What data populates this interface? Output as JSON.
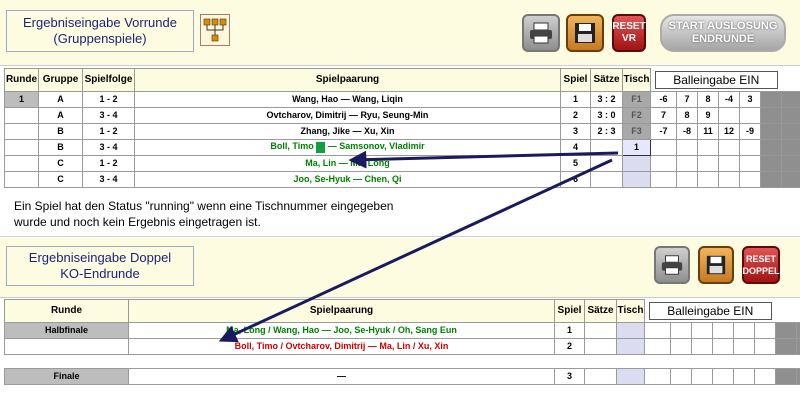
{
  "vr": {
    "title_line1": "Ergebniseingabe Vorrunde",
    "title_line2": "(Gruppenspiele)",
    "icons": {
      "tree": "bracket-tree-icon",
      "print": "printer-icon",
      "save": "floppy-disk-icon"
    },
    "reset_label": "RESET VR",
    "start_label": "START AUSLOSUNG ENDRUNDE",
    "ball_label": "Balleingabe EIN",
    "headers": {
      "runde": "Runde",
      "gruppe": "Gruppe",
      "spielfolge": "Spielfolge",
      "spielpaarung": "Spielpaarung",
      "spiel": "Spiel",
      "saetze": "Sätze",
      "tisch": "Tisch"
    },
    "rows": [
      {
        "runde": "1",
        "gruppe": "A",
        "folge": "1 - 2",
        "p1": "Wang, Hao",
        "sep": "—",
        "p2": "Wang, Liqin",
        "spiel": "1",
        "saetze": "3 : 2",
        "tisch": "F1",
        "sets": [
          "-6",
          "7",
          "8",
          "-4",
          "3"
        ],
        "color": "black"
      },
      {
        "runde": "",
        "gruppe": "A",
        "folge": "3 - 4",
        "p1": "Ovtcharov, Dimitrij",
        "sep": "—",
        "p2": "Ryu, Seung-Min",
        "spiel": "2",
        "saetze": "3 : 0",
        "tisch": "F2",
        "sets": [
          "7",
          "8",
          "9",
          "",
          ""
        ],
        "color": "black"
      },
      {
        "runde": "",
        "gruppe": "B",
        "folge": "1 - 2",
        "p1": "Zhang, Jike",
        "sep": "—",
        "p2": "Xu, Xin",
        "spiel": "3",
        "saetze": "2 : 3",
        "tisch": "F3",
        "sets": [
          "-7",
          "-8",
          "11",
          "12",
          "-9"
        ],
        "color": "black"
      },
      {
        "runde": "",
        "gruppe": "B",
        "folge": "3 - 4",
        "p1": "Boll, Timo",
        "sep": "—",
        "p2": "Samsonov, Vladimir",
        "spiel": "4",
        "saetze": "",
        "tisch": "1",
        "sets": [
          "",
          "",
          "",
          "",
          ""
        ],
        "color": "green"
      },
      {
        "runde": "",
        "gruppe": "C",
        "folge": "1 - 2",
        "p1": "Ma, Lin",
        "sep": "—",
        "p2": "Ma, Long",
        "spiel": "5",
        "saetze": "",
        "tisch": "",
        "sets": [
          "",
          "",
          "",
          "",
          ""
        ],
        "color": "green"
      },
      {
        "runde": "",
        "gruppe": "C",
        "folge": "3 - 4",
        "p1": "Joo, Se-Hyuk",
        "sep": "—",
        "p2": "Chen, Qi",
        "spiel": "6",
        "saetze": "",
        "tisch": "",
        "sets": [
          "",
          "",
          "",
          "",
          ""
        ],
        "color": "green"
      }
    ]
  },
  "note": {
    "line1": "Ein Spiel hat den Status \"running\" wenn eine Tischnummer eingegeben",
    "line2": "wurde und noch kein Ergebnis eingetragen ist."
  },
  "ko": {
    "title_line1": "Ergebniseingabe Doppel",
    "title_line2": "KO-Endrunde",
    "reset_label": "RESET DOPPEL",
    "ball_label": "Balleingabe EIN",
    "headers": {
      "runde": "Runde",
      "spielpaarung": "Spielpaarung",
      "spiel": "Spiel",
      "saetze": "Sätze",
      "tisch": "Tisch"
    },
    "halbfinale_label": "Halbfinale",
    "match1": {
      "text": "Ma, Long / Wang, Hao  —  Joo, Se-Hyuk / Oh, Sang Eun",
      "spiel": "1"
    },
    "match2": {
      "text": "Boll, Timo / Ovtcharov, Dimitrij  —  Ma, Lin / Xu, Xin",
      "spiel": "2"
    },
    "finale_label": "Finale",
    "finale": {
      "text": "—",
      "spiel": "3"
    }
  },
  "colors": {
    "green": "#008000",
    "red": "#d00000",
    "arrow": "#1a1a5e"
  }
}
